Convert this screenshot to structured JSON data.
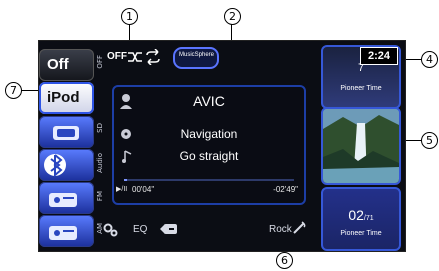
{
  "callouts": {
    "c1": "1",
    "c2": "2",
    "c4": "4",
    "c5": "5",
    "c6": "6",
    "c7": "7"
  },
  "sources": {
    "off": "Off",
    "ipod": "iPod",
    "labels": {
      "off_small": "OFF",
      "sd": "SD",
      "audio": "Audio",
      "fm": "FM",
      "am": "AM"
    }
  },
  "top": {
    "off_label": "OFF",
    "shuffle_icon": "shuffle-icon",
    "repeat_icon": "repeat-icon",
    "logo_text": "MusicSphere"
  },
  "track": {
    "artist": "AVIC",
    "album": "Navigation",
    "title": "Go straight"
  },
  "playback": {
    "elapsed": "00'04\"",
    "remaining": "-02'49\"",
    "progress": 0.02,
    "play_pause": "▶/II"
  },
  "time": {
    "clock": "2:24"
  },
  "cards": {
    "top_number": "7",
    "top_title": "Pioneer Time",
    "bottom_number": "02",
    "bottom_total": "/71",
    "bottom_title": "Pioneer Time"
  },
  "bottom_bar": {
    "settings_icon": "settings-icon",
    "eq_label": "EQ",
    "back_icon": "back-icon",
    "genre_label": "Rock",
    "genre_icon": "tool-icon"
  }
}
